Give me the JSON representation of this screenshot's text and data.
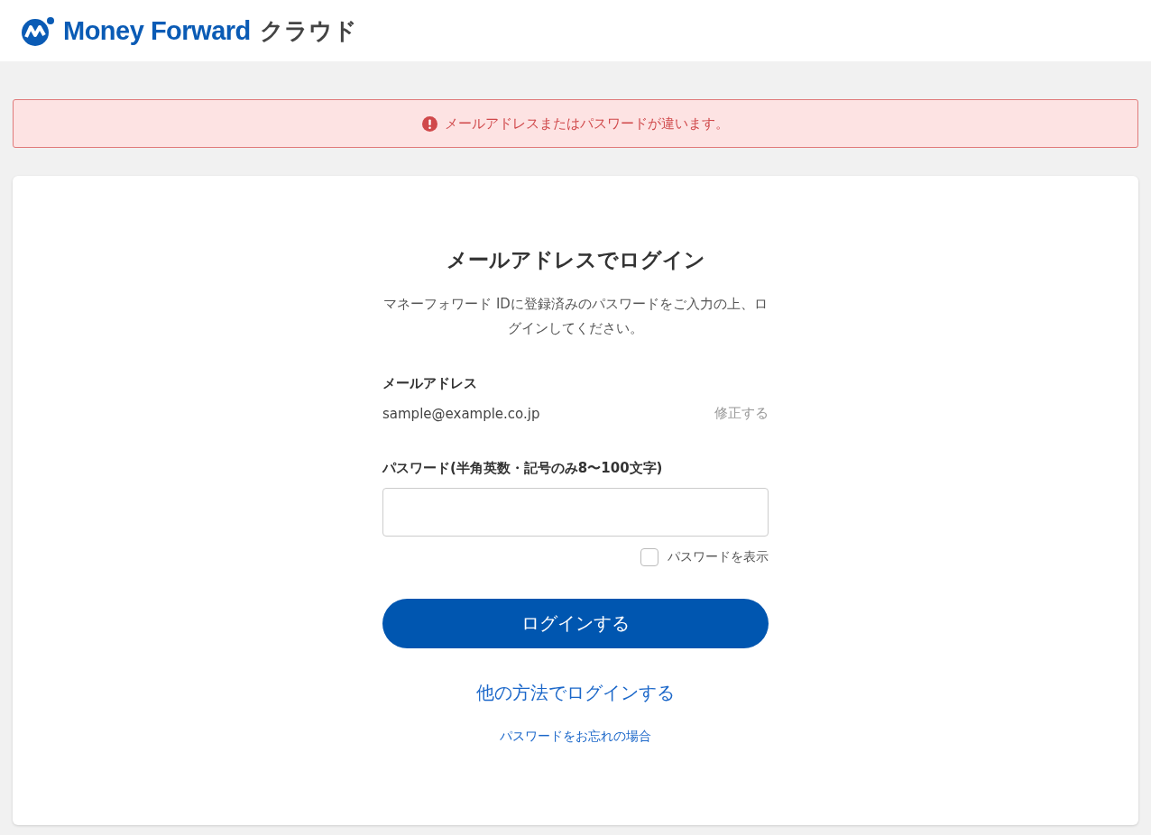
{
  "header": {
    "brand": "Money Forward",
    "product": "クラウド"
  },
  "alert": {
    "message": "メールアドレスまたはパスワードが違います。"
  },
  "login": {
    "title": "メールアドレスでログイン",
    "description": "マネーフォワード IDに登録済みのパスワードをご入力の上、ログインしてください。",
    "email_label": "メールアドレス",
    "email_value": "sample@example.co.jp",
    "edit_link": "修正する",
    "password_label": "パスワード(半角英数・記号のみ8〜100文字)",
    "show_password": {
      "label": "パスワードを表示",
      "checked": false
    },
    "submit": "ログインする",
    "other_method": "他の方法でログインする",
    "forgot": "パスワードをお忘れの場合"
  }
}
